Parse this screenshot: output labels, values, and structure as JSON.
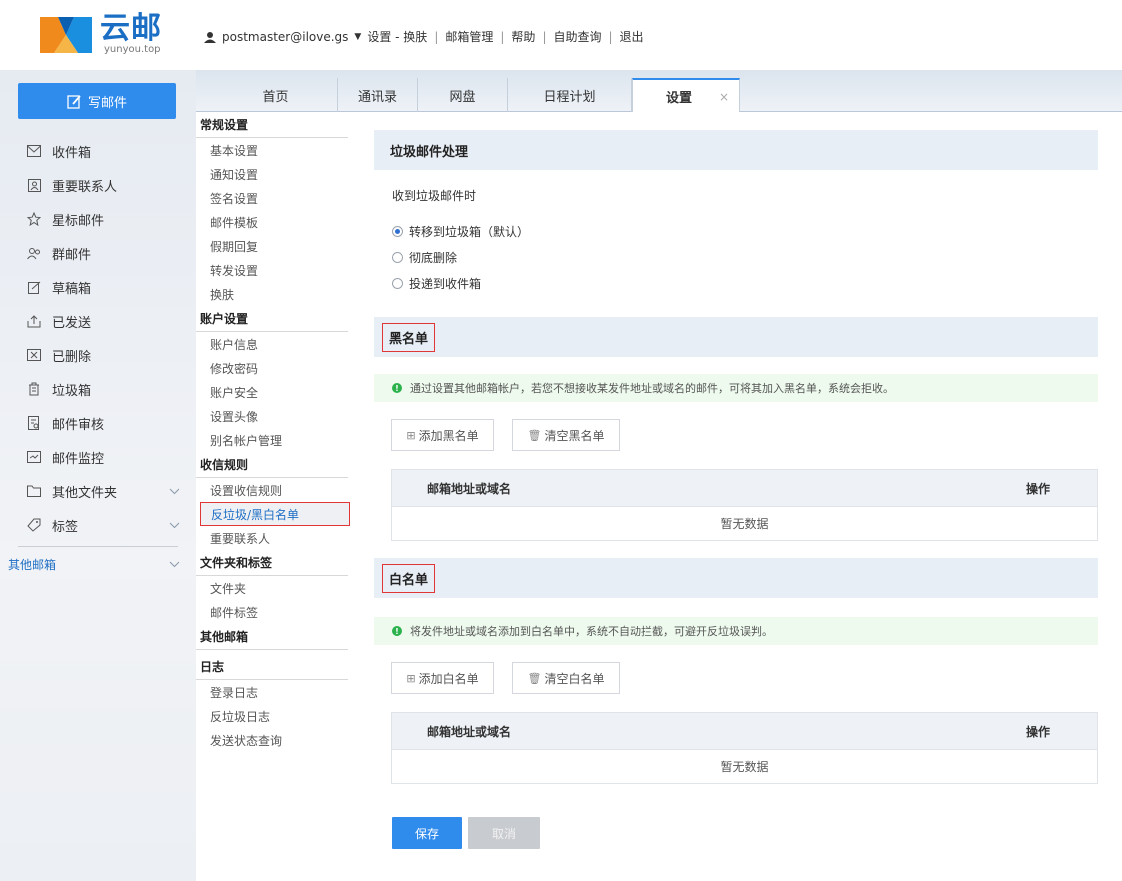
{
  "logo": {
    "title": "云邮",
    "subtitle": "yunyou.top"
  },
  "topnav": {
    "user": "postmaster@ilove.gs",
    "links": [
      "设置 - 换肤",
      "邮箱管理",
      "帮助",
      "自助查询",
      "退出"
    ]
  },
  "sidebar": {
    "compose_label": "写邮件",
    "items": [
      {
        "label": "收件箱",
        "icon": "inbox-icon"
      },
      {
        "label": "重要联系人",
        "icon": "contact-icon"
      },
      {
        "label": "星标邮件",
        "icon": "star-icon"
      },
      {
        "label": "群邮件",
        "icon": "group-icon"
      },
      {
        "label": "草稿箱",
        "icon": "draft-icon"
      },
      {
        "label": "已发送",
        "icon": "sent-icon"
      },
      {
        "label": "已删除",
        "icon": "deleted-icon"
      },
      {
        "label": "垃圾箱",
        "icon": "trash-icon"
      },
      {
        "label": "邮件审核",
        "icon": "review-icon"
      },
      {
        "label": "邮件监控",
        "icon": "monitor-icon"
      },
      {
        "label": "其他文件夹",
        "icon": "folder-icon"
      },
      {
        "label": "标签",
        "icon": "tag-icon"
      }
    ],
    "other_mailbox": "其他邮箱"
  },
  "tabs": [
    "首页",
    "通讯录",
    "网盘",
    "日程计划",
    "设置"
  ],
  "subnav": {
    "groups": [
      {
        "title": "常规设置",
        "items": [
          "基本设置",
          "通知设置",
          "签名设置",
          "邮件模板",
          "假期回复",
          "转发设置",
          "换肤"
        ]
      },
      {
        "title": "账户设置",
        "items": [
          "账户信息",
          "修改密码",
          "账户安全",
          "设置头像",
          "别名帐户管理"
        ]
      },
      {
        "title": "收信规则",
        "items": [
          "设置收信规则",
          "反垃圾/黑白名单",
          "重要联系人"
        ]
      },
      {
        "title": "文件夹和标签",
        "items": [
          "文件夹",
          "邮件标签"
        ]
      },
      {
        "title": "其他邮箱",
        "items": []
      },
      {
        "title": "日志",
        "items": [
          "登录日志",
          "反垃圾日志",
          "发送状态查询"
        ]
      }
    ]
  },
  "spam": {
    "title": "垃圾邮件处理",
    "prompt": "收到垃圾邮件时",
    "options": [
      "转移到垃圾箱（默认）",
      "彻底删除",
      "投递到收件箱"
    ],
    "selected": 0
  },
  "blacklist": {
    "title": "黑名单",
    "notice": "通过设置其他邮箱帐户，若您不想接收某发件地址或域名的邮件，可将其加入黑名单，系统会拒收。",
    "add_label": "添加黑名单",
    "clear_label": "清空黑名单",
    "col_address": "邮箱地址或域名",
    "col_action": "操作",
    "empty": "暂无数据"
  },
  "whitelist": {
    "title": "白名单",
    "notice": "将发件地址或域名添加到白名单中，系统不自动拦截，可避开反垃圾误判。",
    "add_label": "添加白名单",
    "clear_label": "清空白名单",
    "col_address": "邮箱地址或域名",
    "col_action": "操作",
    "empty": "暂无数据"
  },
  "actions": {
    "save": "保存",
    "cancel": "取消"
  },
  "colors": {
    "accent": "#2f8bec",
    "highlight": "#e03636",
    "notice_green": "#2bb24c"
  }
}
